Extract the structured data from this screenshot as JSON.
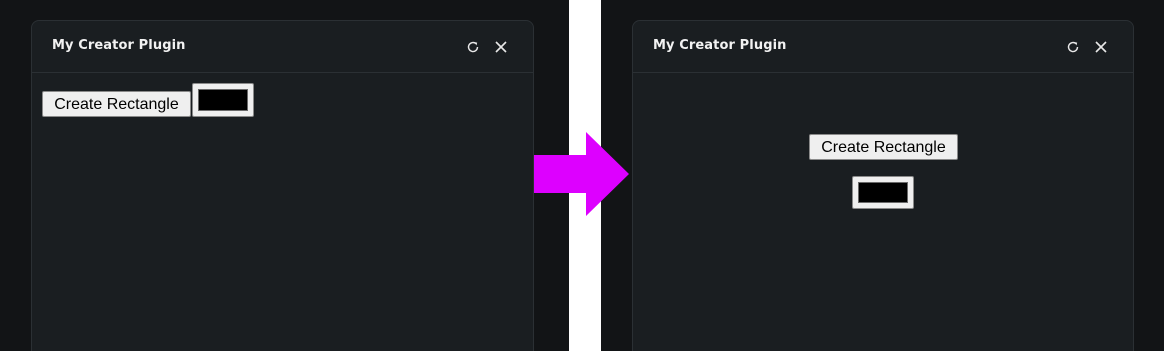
{
  "before": {
    "window_title": "My Creator Plugin",
    "button_label": "Create Rectangle",
    "color_value": "#000000"
  },
  "after": {
    "window_title": "My Creator Plugin",
    "button_label": "Create Rectangle",
    "color_value": "#000000"
  },
  "colors": {
    "arrow": "#dd00ff",
    "window_bg": "#1a1e21",
    "page_bg": "#121416"
  },
  "icons": {
    "refresh": "refresh-icon",
    "close": "close-icon"
  }
}
